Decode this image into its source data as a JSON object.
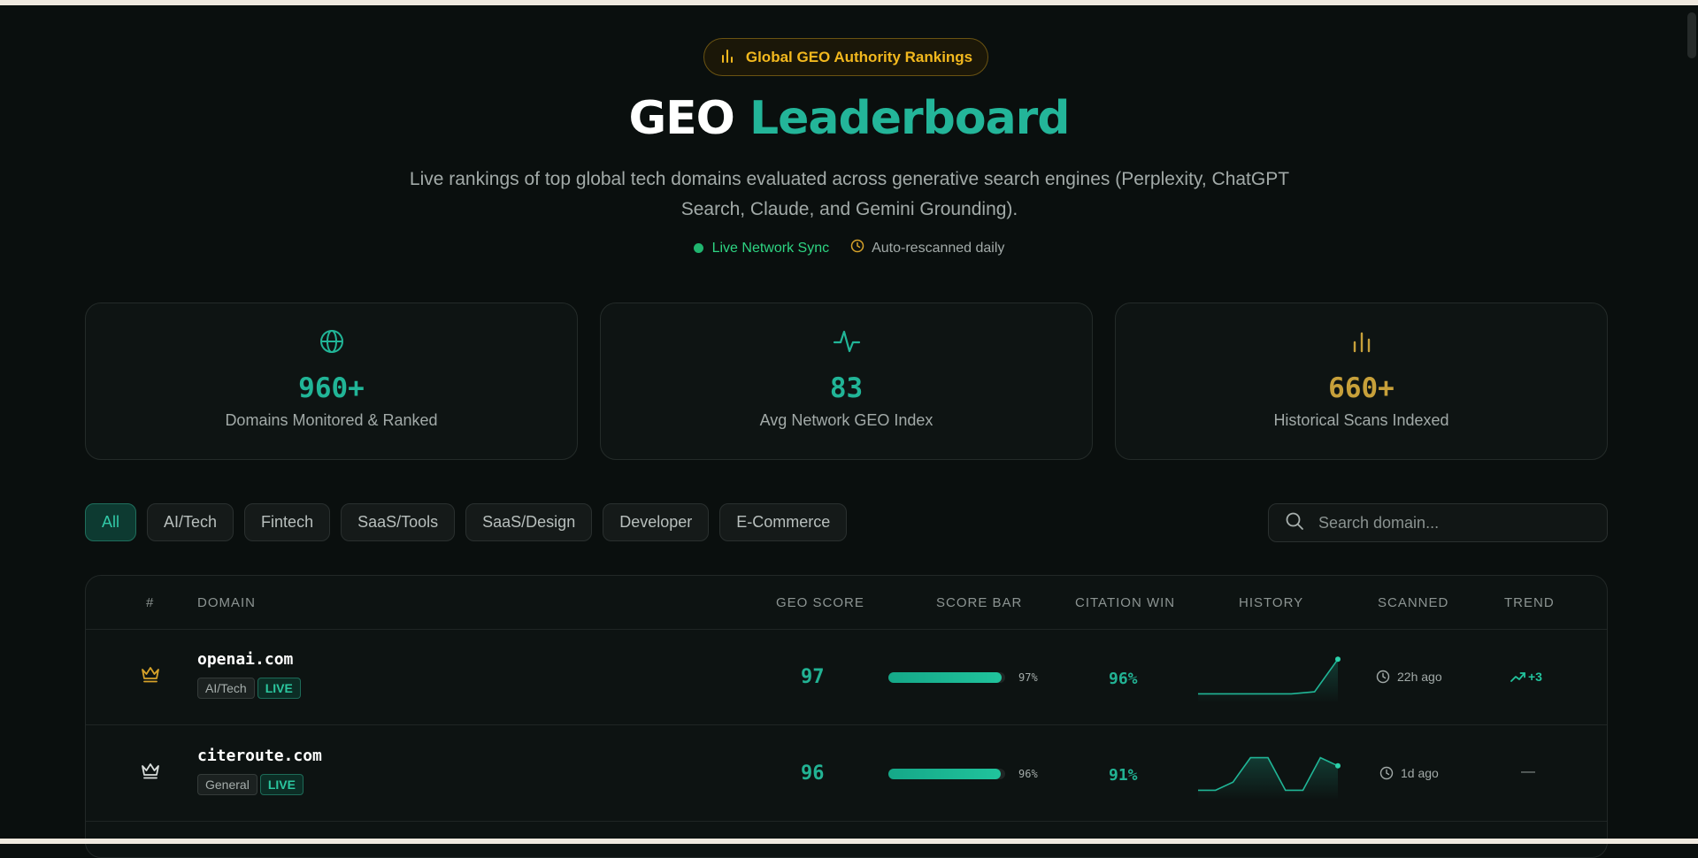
{
  "hero": {
    "badge": "Global GEO Authority Rankings",
    "title_part1": "GEO",
    "title_part2": "Leaderboard",
    "subtitle": "Live rankings of top global tech domains evaluated across generative search engines (Perplexity, ChatGPT Search, Claude, and Gemini Grounding).",
    "live_status": "Live Network Sync",
    "rescan_status": "Auto-rescanned daily"
  },
  "stats": [
    {
      "icon": "globe-icon",
      "value": "960+",
      "caption": "Domains Monitored & Ranked",
      "color": "#21b597"
    },
    {
      "icon": "activity-icon",
      "value": "83",
      "caption": "Avg Network GEO Index",
      "color": "#21b597"
    },
    {
      "icon": "bar-chart-icon",
      "value": "660+",
      "caption": "Historical Scans Indexed",
      "color": "#c7a03a"
    }
  ],
  "filters": [
    "All",
    "AI/Tech",
    "Fintech",
    "SaaS/Tools",
    "SaaS/Design",
    "Developer",
    "E-Commerce"
  ],
  "active_filter": "All",
  "search": {
    "placeholder": "Search domain..."
  },
  "table": {
    "headers": {
      "rank": "#",
      "domain": "DOMAIN",
      "geo_score": "GEO SCORE",
      "score_bar": "SCORE BAR",
      "citation_win": "CITATION WIN",
      "history": "HISTORY",
      "scanned": "SCANNED",
      "trend": "TREND"
    },
    "rows": [
      {
        "rank_icon": "crown-icon",
        "domain": "openai.com",
        "category": "AI/Tech",
        "live_tag": "LIVE",
        "geo_score": "97",
        "score_fraction": 0.97,
        "score_pct": "97%",
        "citation_win": "96%",
        "history": [
          80,
          80,
          80,
          80,
          80,
          81,
          97
        ],
        "scanned": "22h  ago",
        "trend": "+3",
        "trend_icon": "trending-up-icon"
      },
      {
        "rank_icon": "crown-icon",
        "domain": "citeroute.com",
        "category": "General",
        "live_tag": "LIVE",
        "geo_score": "96",
        "score_fraction": 0.96,
        "score_pct": "96%",
        "citation_win": "91%",
        "history": [
          80,
          80,
          84,
          96,
          96,
          80,
          80,
          96,
          92
        ],
        "scanned": "1d  ago",
        "trend": "—",
        "trend_icon": ""
      }
    ]
  },
  "colors": {
    "accent": "#21b597",
    "gold": "#f2b81e",
    "background": "#0a0f0e"
  }
}
